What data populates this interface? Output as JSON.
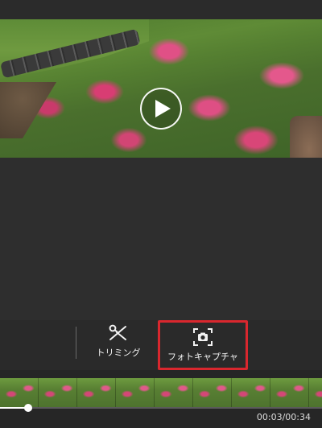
{
  "video": {
    "play_icon": "play-icon"
  },
  "toolbar": {
    "trim": {
      "label": "トリミング",
      "icon": "scissors-icon"
    },
    "capture": {
      "label": "フォトキャプチャ",
      "icon": "camera-capture-icon",
      "highlight_color": "#d9272e"
    }
  },
  "playback": {
    "time": "00:03/00:34",
    "progress_fraction": 0.088
  },
  "colors": {
    "background": "#262626",
    "toolbar": "#2a2a2a",
    "text": "#f2f2f2"
  }
}
